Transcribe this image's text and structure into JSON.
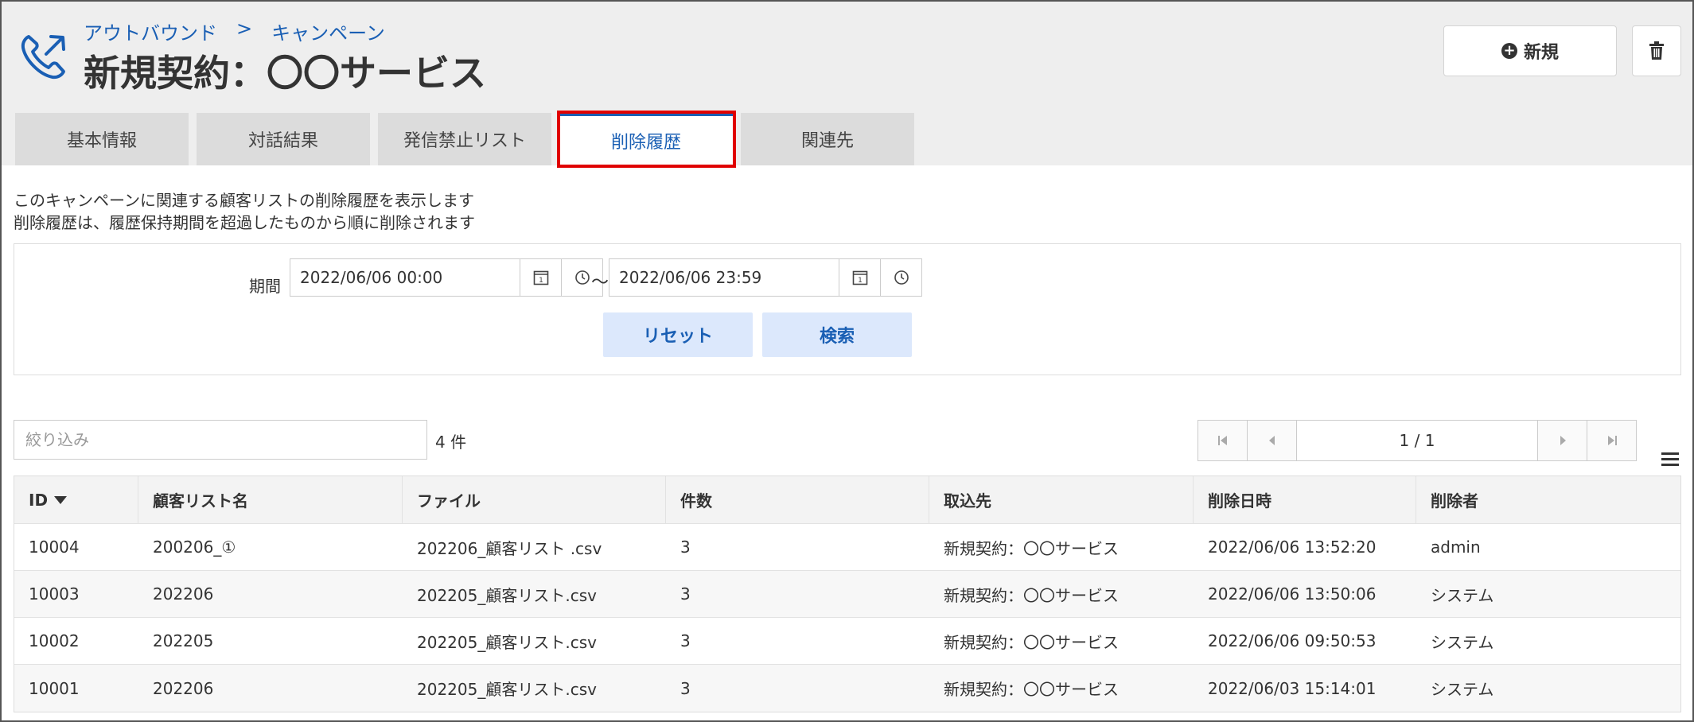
{
  "header": {
    "breadcrumb": [
      "アウトバウンド",
      ">",
      "キャンペーン"
    ],
    "title": "新規契約：〇〇サービス",
    "new_button": "新規",
    "accent_color": "#1a5fb4"
  },
  "tabs": [
    {
      "label": "基本情報",
      "active": false
    },
    {
      "label": "対話結果",
      "active": false
    },
    {
      "label": "発信禁止リスト",
      "active": false
    },
    {
      "label": "削除履歴",
      "active": true
    },
    {
      "label": "関連先",
      "active": false
    }
  ],
  "description": {
    "line1": "このキャンペーンに関連する顧客リストの削除履歴を表示します",
    "line2": "削除履歴は、履歴保持期間を超過したものから順に削除されます"
  },
  "search": {
    "period_label": "期間",
    "from_value": "2022/06/06 00:00",
    "to_value": "2022/06/06 23:59",
    "separator": "～",
    "reset_button": "リセット",
    "search_button": "検索"
  },
  "filter": {
    "placeholder": "絞り込み",
    "count_text": "4 件"
  },
  "pager": {
    "info": "1 / 1"
  },
  "table": {
    "columns": [
      "ID",
      "顧客リスト名",
      "ファイル",
      "件数",
      "取込先",
      "削除日時",
      "削除者"
    ],
    "rows": [
      [
        "10004",
        "200206_①",
        "202206_顧客リスト .csv",
        "3",
        "新規契約：〇〇サービス",
        "2022/06/06 13:52:20",
        "admin"
      ],
      [
        "10003",
        "202206",
        "202205_顧客リスト.csv",
        "3",
        "新規契約：〇〇サービス",
        "2022/06/06 13:50:06",
        "システム"
      ],
      [
        "10002",
        "202205",
        "202205_顧客リスト.csv",
        "3",
        "新規契約：〇〇サービス",
        "2022/06/06 09:50:53",
        "システム"
      ],
      [
        "10001",
        "202206",
        "202205_顧客リスト.csv",
        "3",
        "新規契約：〇〇サービス",
        "2022/06/03 15:14:01",
        "システム"
      ]
    ]
  }
}
